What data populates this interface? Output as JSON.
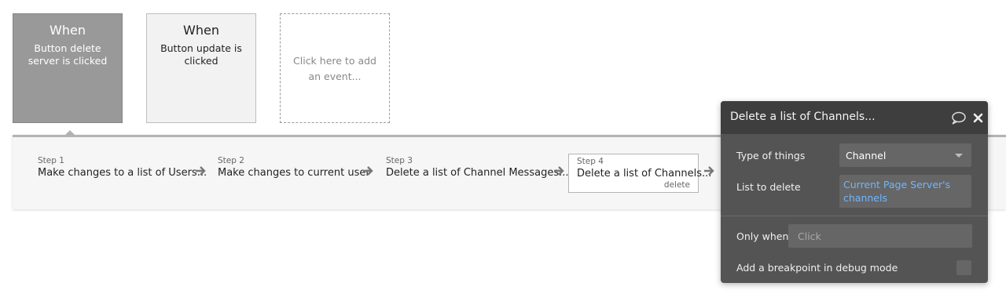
{
  "events": [
    {
      "title": "When",
      "description": "Button delete server is clicked"
    },
    {
      "title": "When",
      "description": "Button update is clicked"
    }
  ],
  "add_event": {
    "label": "Click here to add an event..."
  },
  "steps": [
    {
      "number": "Step 1",
      "name": "Make changes to a list of Users..."
    },
    {
      "number": "Step 2",
      "name": "Make changes to current user"
    },
    {
      "number": "Step 3",
      "name": "Delete a list of Channel Messages..."
    },
    {
      "number": "Step 4",
      "name": "Delete a list of Channels...",
      "action": "delete"
    }
  ],
  "icons": {
    "arrow": "arrow-right-icon",
    "comment": "comment-icon",
    "close": "close-icon",
    "caret": "chevron-down-icon"
  },
  "panel": {
    "title": "Delete a list of Channels...",
    "type_label": "Type of things",
    "type_value": "Channel",
    "list_label": "List to delete",
    "list_value": "Current Page Server's channels",
    "only_when_label": "Only when",
    "only_when_placeholder": "Click",
    "breakpoint_label": "Add a breakpoint in debug mode"
  },
  "colors": {
    "active_event": "#999999",
    "panel_bg": "#545454",
    "panel_header": "#3e3e3e",
    "link_blue": "#6fb6ff"
  }
}
